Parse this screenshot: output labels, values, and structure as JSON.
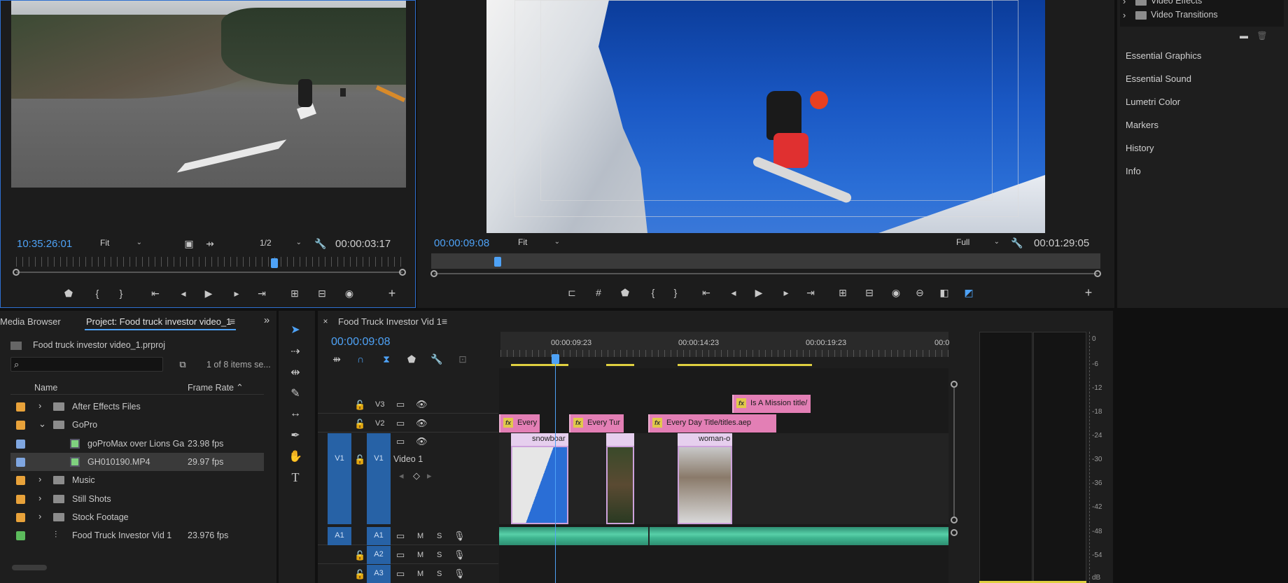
{
  "source_monitor": {
    "timecode": "10:35:26:01",
    "fit": "Fit",
    "resolution": "1/2",
    "duration": "00:00:03:17",
    "playhead_fraction": 0.67
  },
  "program_monitor": {
    "timecode": "00:00:09:08",
    "fit": "Fit",
    "quality": "Full",
    "duration": "00:01:29:05",
    "playhead_fraction": 0.1
  },
  "right_panel": {
    "effects_items": [
      "Video Effects",
      "Video Transitions"
    ],
    "menu": [
      "Essential Graphics",
      "Essential Sound",
      "Lumetri Color",
      "Markers",
      "History",
      "Info"
    ]
  },
  "project_panel": {
    "tab_media": "Media Browser",
    "tab_project": "Project: Food truck investor video_1",
    "file": "Food truck investor video_1.prproj",
    "items_count": "1 of 8 items se...",
    "col_name": "Name",
    "col_rate": "Frame Rate",
    "rows": [
      {
        "name": "After Effects Files",
        "rate": "",
        "color": "#e8a23a",
        "type": "folder",
        "indent": 0,
        "arrow": "›"
      },
      {
        "name": "GoPro",
        "rate": "",
        "color": "#e8a23a",
        "type": "folder",
        "indent": 0,
        "arrow": "⌄"
      },
      {
        "name": "goProMax over Lions Ga",
        "rate": "23.98 fps",
        "color": "#7fa6e0",
        "type": "clip",
        "indent": 1,
        "arrow": ""
      },
      {
        "name": "GH010190.MP4",
        "rate": "29.97 fps",
        "color": "#7fa6e0",
        "type": "clip",
        "indent": 1,
        "arrow": ""
      },
      {
        "name": "Music",
        "rate": "",
        "color": "#e8a23a",
        "type": "folder",
        "indent": 0,
        "arrow": "›"
      },
      {
        "name": "Still Shots",
        "rate": "",
        "color": "#e8a23a",
        "type": "folder",
        "indent": 0,
        "arrow": "›"
      },
      {
        "name": "Stock Footage",
        "rate": "",
        "color": "#e8a23a",
        "type": "folder",
        "indent": 0,
        "arrow": "›"
      },
      {
        "name": "Food Truck Investor Vid 1",
        "rate": "23.976 fps",
        "color": "#5cbb5c",
        "type": "sequence",
        "indent": 0,
        "arrow": ""
      }
    ]
  },
  "timeline": {
    "tab": "Food Truck Investor Vid 1",
    "timecode": "00:00:09:08",
    "ruler": [
      "00:00:09:23",
      "00:00:14:23",
      "00:00:19:23",
      "00:0"
    ],
    "tracks": {
      "v3": "V3",
      "v2": "V2",
      "v1": "V1",
      "v1_src": "V1",
      "v1_name": "Video 1",
      "a1": "A1",
      "a1_src": "A1",
      "a2": "A2",
      "a3": "A3",
      "m": "M",
      "s": "S"
    },
    "title_clips": [
      "Is A Mission title/",
      "Every",
      "Every Tur",
      "Every Day Title/titles.aep"
    ],
    "video_clips": [
      "snowboar",
      "",
      "woman-o"
    ],
    "fx": "fx"
  },
  "meter_scale": [
    "0",
    "-6",
    "-12",
    "-18",
    "-24",
    "-30",
    "-36",
    "-42",
    "-48",
    "-54",
    "dB"
  ]
}
